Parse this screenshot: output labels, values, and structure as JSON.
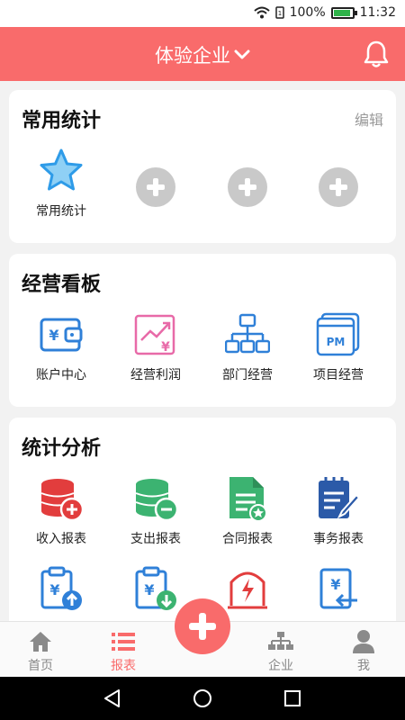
{
  "status_bar": {
    "battery": "100%",
    "time": "11:32"
  },
  "header": {
    "title": "体验企业",
    "dropdown_icon": "chevron-down-icon",
    "bell_icon": "bell-icon"
  },
  "colors": {
    "accent": "#f96b6b",
    "blue": "#2f80d8",
    "green": "#3cb371",
    "red": "#e23d3d"
  },
  "favorites": {
    "title": "常用统计",
    "edit_label": "编辑",
    "items": [
      {
        "label": "常用统计",
        "icon": "star-icon"
      },
      {
        "label": "",
        "icon": "add-icon"
      },
      {
        "label": "",
        "icon": "add-icon"
      },
      {
        "label": "",
        "icon": "add-icon"
      }
    ]
  },
  "dashboard": {
    "title": "经营看板",
    "items": [
      {
        "label": "账户中心",
        "icon": "wallet-icon"
      },
      {
        "label": "经营利润",
        "icon": "profit-chart-icon"
      },
      {
        "label": "部门经营",
        "icon": "org-chart-icon"
      },
      {
        "label": "项目经营",
        "icon": "project-pm-icon"
      }
    ]
  },
  "analysis": {
    "title": "统计分析",
    "items": [
      {
        "label": "收入报表",
        "icon": "income-coins-icon"
      },
      {
        "label": "支出报表",
        "icon": "expense-coins-icon"
      },
      {
        "label": "合同报表",
        "icon": "contract-doc-icon"
      },
      {
        "label": "事务报表",
        "icon": "notepad-pen-icon"
      },
      {
        "label": "",
        "icon": "clipboard-upload-icon"
      },
      {
        "label": "",
        "icon": "clipboard-download-icon"
      },
      {
        "label": "",
        "icon": "alert-sign-icon"
      },
      {
        "label": "",
        "icon": "yen-return-icon"
      }
    ]
  },
  "tabbar": {
    "tabs": [
      {
        "label": "首页",
        "icon": "home-icon"
      },
      {
        "label": "报表",
        "icon": "list-icon"
      },
      {
        "label": "企业",
        "icon": "org-icon"
      },
      {
        "label": "我",
        "icon": "user-icon"
      }
    ],
    "active": "报表",
    "fab_icon": "add-icon"
  },
  "navbar": {
    "icons": [
      "back-icon",
      "home-circle-icon",
      "recents-icon"
    ]
  }
}
